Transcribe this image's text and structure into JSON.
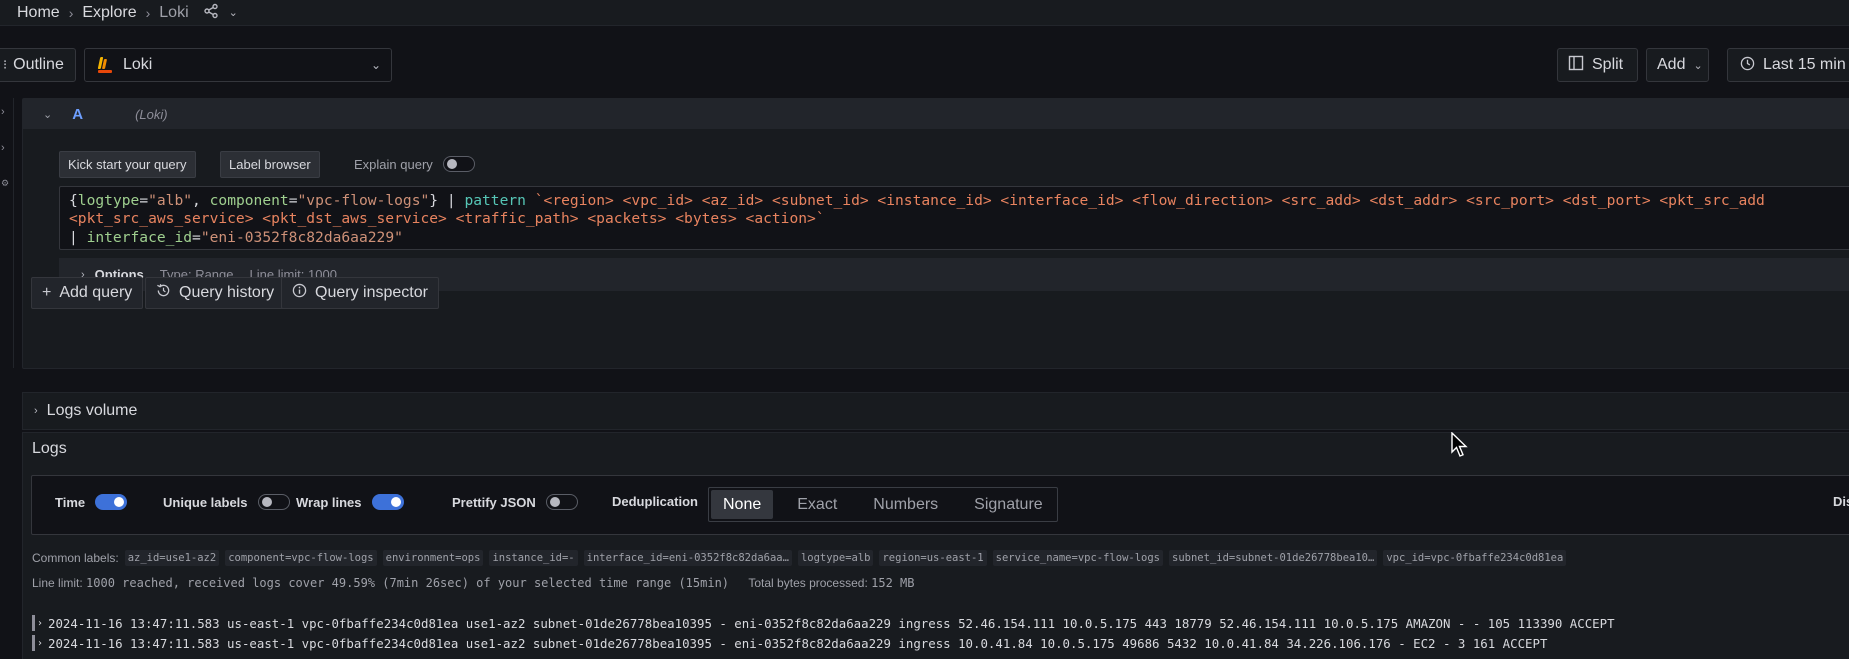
{
  "breadcrumb": {
    "home": "Home",
    "explore": "Explore",
    "current": "Loki"
  },
  "toolbar": {
    "outline_label": "Outline",
    "datasource_label": "Loki",
    "split_label": "Split",
    "add_label": "Add",
    "time_label": "Last 15 min"
  },
  "query": {
    "ref_id": "A",
    "datasource_hint": "(Loki)",
    "kick_start_label": "Kick start your query",
    "label_browser_label": "Label browser",
    "explain_label": "Explain query",
    "explain_enabled": false,
    "expr_line1": {
      "p1": "{",
      "k1": "logtype",
      "p2": "=",
      "s1": "\"alb\"",
      "p3": ", ",
      "k2": "component",
      "p4": "=",
      "s2": "\"vpc-flow-logs\"",
      "p5": "} | ",
      "fn": "pattern",
      "p6": " ",
      "pat": "`<region> <vpc_id> <az_id> <subnet_id> <instance_id> <interface_id> <flow_direction> <src_add> <dst_addr> <src_port> <dst_port> <pkt_src_add"
    },
    "expr_line2": "<pkt_src_aws_service> <pkt_dst_aws_service> <traffic_path> <packets> <bytes> <action>`",
    "expr_line3": {
      "pipe": "| ",
      "key": "interface_id",
      "eq": "=",
      "val": "\"eni-0352f8c82da6aa229\""
    },
    "options": {
      "title": "Options",
      "type": "Type: Range",
      "limit": "Line limit: 1000"
    },
    "add_query_label": "Add query",
    "history_label": "Query history",
    "inspector_label": "Query inspector"
  },
  "logs_volume": {
    "title": "Logs volume"
  },
  "logs": {
    "title": "Logs",
    "controls": {
      "time_label": "Time",
      "time_on": true,
      "unique_labels_label": "Unique labels",
      "unique_on": false,
      "wrap_lines_label": "Wrap lines",
      "wrap_on": true,
      "prettify_label": "Prettify JSON",
      "prettify_on": false,
      "dedup_label": "Deduplication",
      "dedup_options": [
        "None",
        "Exact",
        "Numbers",
        "Signature"
      ],
      "dedup_selected": "None",
      "display_label": "Disp"
    },
    "common_labels_title": "Common labels:",
    "common_labels": [
      "az_id=use1-az2",
      "component=vpc-flow-logs",
      "environment=ops",
      "instance_id=-",
      "interface_id=eni-0352f8c82da6aa…",
      "logtype=alb",
      "region=us-east-1",
      "service_name=vpc-flow-logs",
      "subnet_id=subnet-01de26778bea10…",
      "vpc_id=vpc-0fbaffe234c0d81ea"
    ],
    "line_limit_title": "Line limit:",
    "line_limit_text": "1000 reached, received logs cover 49.59% (7min 26sec) of your selected time range (15min)",
    "bytes_title": "Total bytes processed:",
    "bytes_value": "152 MB",
    "rows": [
      "2024-11-16 13:47:11.583 us-east-1 vpc-0fbaffe234c0d81ea use1-az2 subnet-01de26778bea10395 - eni-0352f8c82da6aa229 ingress 52.46.154.111 10.0.5.175 443 18779 52.46.154.111 10.0.5.175 AMAZON - - 105 113390 ACCEPT",
      "2024-11-16 13:47:11.583 us-east-1 vpc-0fbaffe234c0d81ea use1-az2 subnet-01de26778bea10395 - eni-0352f8c82da6aa229 ingress 10.0.41.84 10.0.5.175 49686 5432 10.0.41.84 34.226.106.176 - EC2 - 3 161 ACCEPT"
    ]
  },
  "colors": {
    "accent": "#3d71d9",
    "background": "#111217",
    "panel": "#181b1f",
    "query_letter": "#6e9fff"
  }
}
